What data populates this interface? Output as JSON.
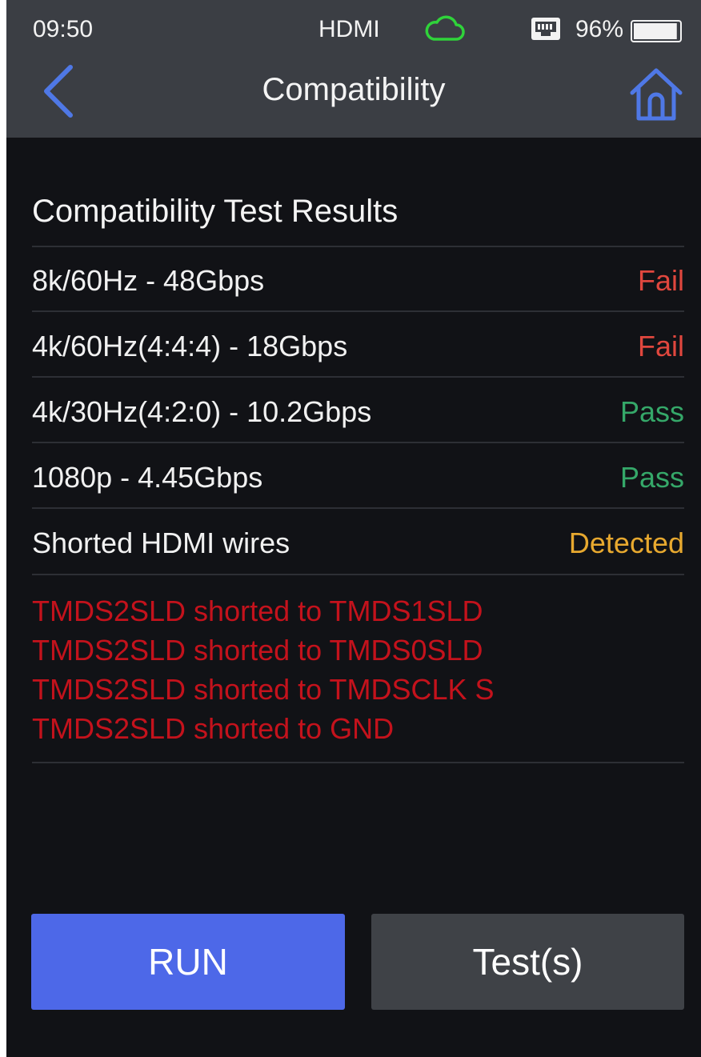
{
  "status_bar": {
    "time": "09:50",
    "connection": "HDMI",
    "battery_percent": "96%",
    "battery_level": 0.96,
    "icons": [
      "cloud-icon",
      "ethernet-icon",
      "battery-icon"
    ],
    "cloud_color": "#2fd33a"
  },
  "header": {
    "title": "Compatibility",
    "back_icon": "chevron-left-icon",
    "home_icon": "home-icon",
    "accent": "#4f78e6"
  },
  "results": {
    "title": "Compatibility Test Results",
    "rows": [
      {
        "label": "8k/60Hz - 48Gbps",
        "status": "Fail"
      },
      {
        "label": "4k/60Hz(4:4:4) - 18Gbps",
        "status": "Fail"
      },
      {
        "label": "4k/30Hz(4:2:0) - 10.2Gbps",
        "status": "Pass"
      },
      {
        "label": "1080p - 4.45Gbps",
        "status": "Pass"
      },
      {
        "label": "Shorted HDMI wires",
        "status": "Detected"
      }
    ],
    "errors": [
      "TMDS2SLD shorted to TMDS1SLD",
      "TMDS2SLD shorted to TMDS0SLD",
      "TMDS2SLD shorted to TMDSCLK S",
      "TMDS2SLD shorted to GND"
    ]
  },
  "colors": {
    "fail": "#e0473e",
    "pass": "#35a869",
    "detected": "#e8a92f",
    "error_text": "#c4121c",
    "run_button": "#4d68e8",
    "tests_button": "#3f4247"
  },
  "buttons": {
    "run_label": "RUN",
    "tests_label": "Test(s)"
  }
}
